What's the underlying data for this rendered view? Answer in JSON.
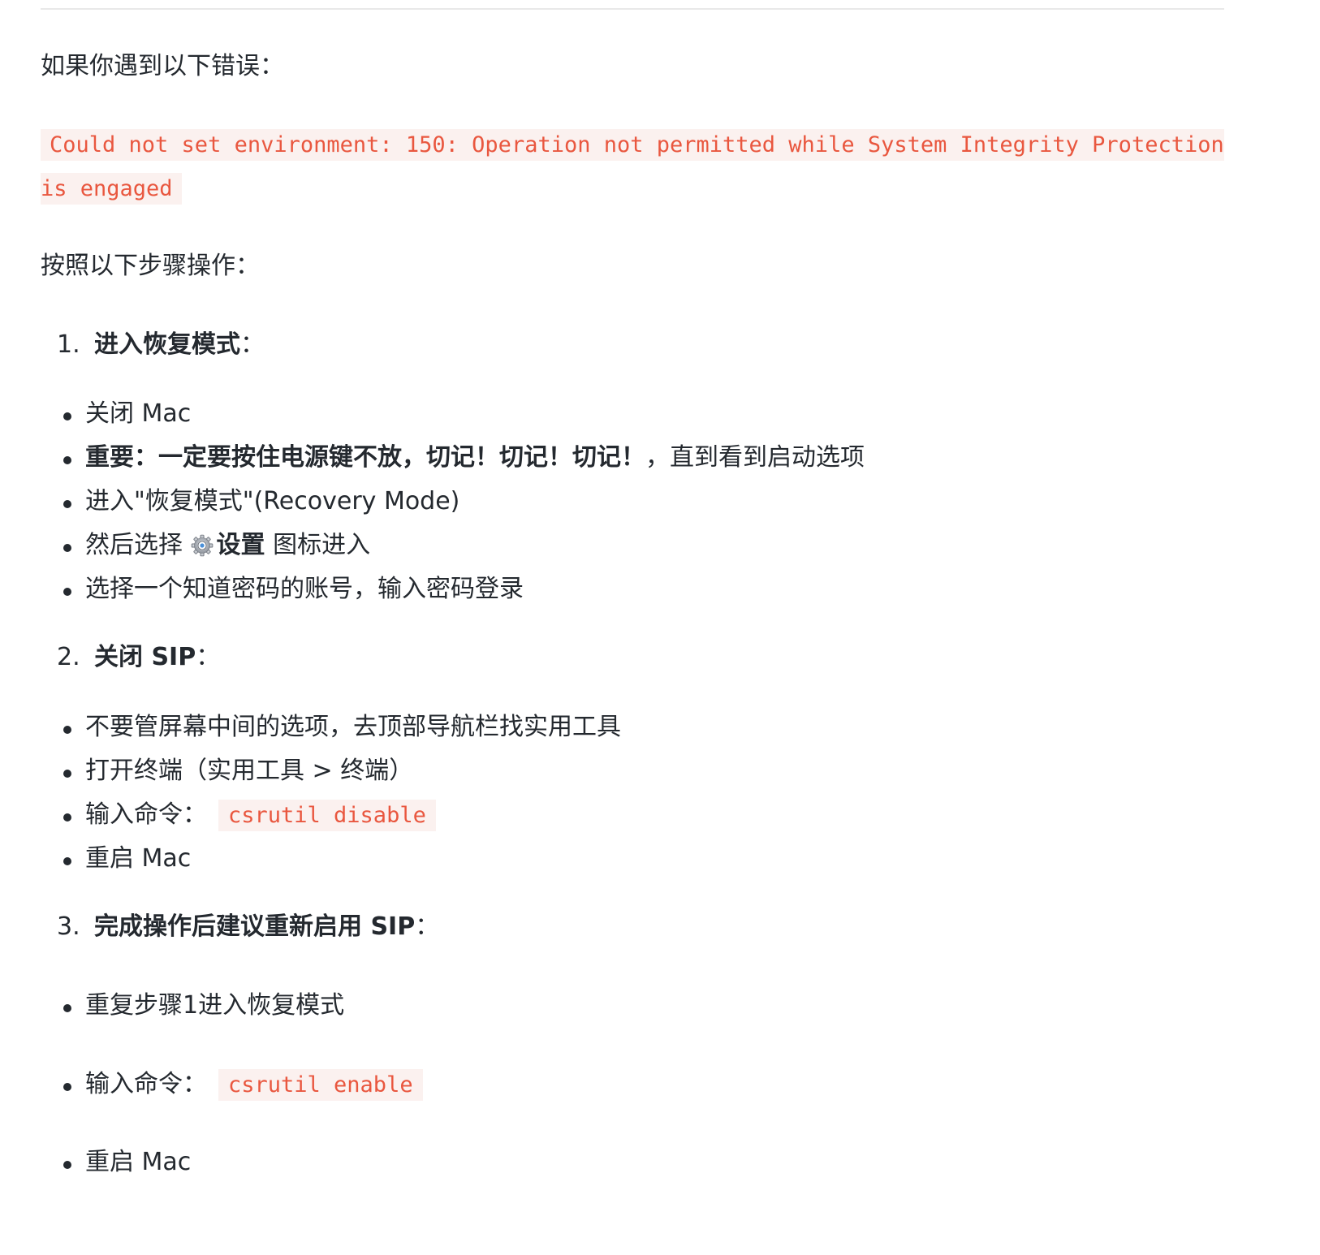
{
  "intro": "如果你遇到以下错误：",
  "error": {
    "line1": "Could not set environment: 150: Operation not permitted while System Integrity Protection",
    "line2": "is engaged"
  },
  "follow": "按照以下步骤操作：",
  "step1": {
    "number": "1.",
    "title": "进入恢复模式",
    "suffix": "：",
    "bullets": {
      "b1": "关闭 Mac",
      "b2_bold": "重要：一定要按住电源键不放，切记！切记！切记！",
      "b2_rest": "，直到看到启动选项",
      "b3": "进入\"恢复模式\"(Recovery Mode)",
      "b4_pre": "然后选择 ",
      "b4_bold": "设置",
      "b4_post": " 图标进入",
      "b4_icon": "gear-icon",
      "b5": "选择一个知道密码的账号，输入密码登录"
    }
  },
  "step2": {
    "number": "2.",
    "title": "关闭 SIP",
    "suffix": "：",
    "bullets": {
      "b1": "不要管屏幕中间的选项，去顶部导航栏找实用工具",
      "b2": "打开终端（实用工具 > 终端）",
      "b3_label": "输入命令：",
      "b3_code": "csrutil disable",
      "b4": "重启 Mac"
    }
  },
  "step3": {
    "number": "3.",
    "title": "完成操作后建议重新启用 SIP",
    "suffix": "：",
    "bullets": {
      "b1": "重复步骤1进入恢复模式",
      "b2_label": "输入命令：",
      "b2_code": "csrutil enable",
      "b3": "重启 Mac"
    }
  },
  "colors": {
    "code_text": "#e9573f",
    "code_bg": "#fbf1ef",
    "body_text": "#24292f"
  }
}
